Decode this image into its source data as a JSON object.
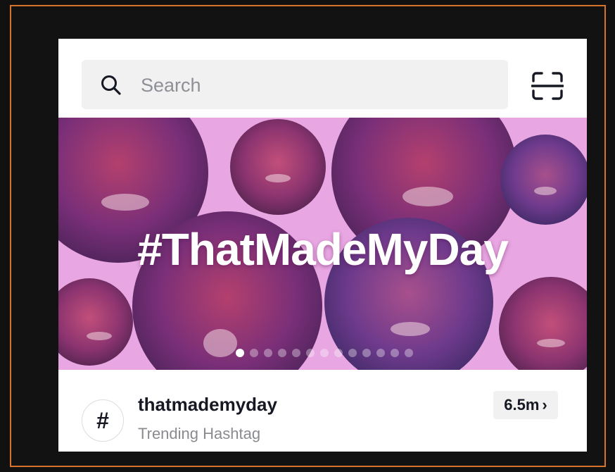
{
  "search": {
    "placeholder": "Search",
    "search_icon": "search-icon",
    "scan_icon": "scan-icon"
  },
  "banner": {
    "title": "#ThatMadeMyDay",
    "background_color": "#e8a6e2",
    "carousel_dot_count": 13,
    "carousel_active_index": 0
  },
  "hashtag": {
    "icon_glyph": "#",
    "name": "thatmademyday",
    "subtitle": "Trending Hashtag",
    "count": "6.5m",
    "chevron": "›"
  },
  "colors": {
    "frame_border": "#d8732a",
    "text_primary": "#161823",
    "text_secondary": "#8a8b91",
    "surface_gray": "#f1f1f2"
  }
}
